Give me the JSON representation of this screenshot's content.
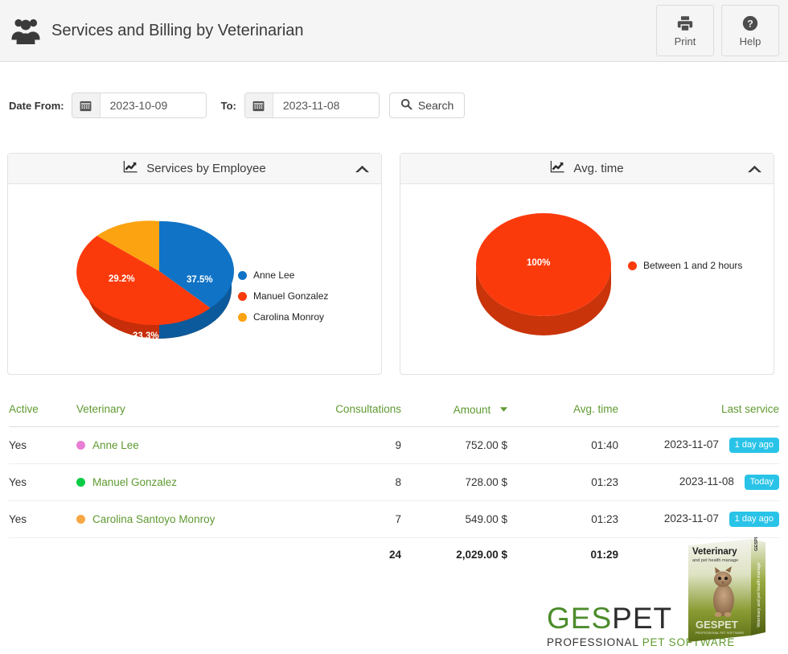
{
  "header": {
    "title": "Services and Billing by Veterinarian",
    "icon": "users-group-icon",
    "buttons": [
      {
        "label": "Print",
        "icon": "printer-icon"
      },
      {
        "label": "Help",
        "icon": "question-circle-icon"
      }
    ]
  },
  "filter": {
    "date_from_label": "Date From:",
    "date_from_value": "2023-10-09",
    "to_label": "To:",
    "date_to_value": "2023-11-08",
    "search_label": "Search",
    "calendar_icon": "calendar-icon",
    "search_icon": "search-icon"
  },
  "panels": [
    {
      "title": "Services by Employee",
      "icon": "chart-line-icon",
      "collapse_icon": "chevron-up-icon"
    },
    {
      "title": "Avg. time",
      "icon": "chart-line-icon",
      "collapse_icon": "chevron-up-icon"
    }
  ],
  "chart_data": [
    {
      "type": "pie",
      "title": "Services by Employee",
      "categories": [
        "Anne Lee",
        "Manuel  Gonzalez",
        "Carolina Monroy"
      ],
      "values": [
        37.5,
        33.3,
        29.2
      ],
      "labels": [
        "37.5%",
        "33.3%",
        "29.2%"
      ],
      "colors": [
        "#1073c6",
        "#fb3a0c",
        "#fca311"
      ],
      "legend_position": "right",
      "legend": [
        "Anne Lee",
        "Manuel  Gonzalez",
        "Carolina Monroy"
      ],
      "unit": "%"
    },
    {
      "type": "pie",
      "title": "Avg. time",
      "categories": [
        "Between 1 and 2 hours"
      ],
      "values": [
        100
      ],
      "labels": [
        "100%"
      ],
      "colors": [
        "#fb3a0c"
      ],
      "legend_position": "right",
      "legend": [
        "Between 1 and 2 hours"
      ],
      "unit": "%"
    }
  ],
  "table": {
    "columns": [
      "Active",
      "Veterinary",
      "Consultations",
      "Amount",
      "Avg. time",
      "Last service"
    ],
    "sorted_column": "Amount",
    "sort_direction": "desc",
    "rows": [
      {
        "active": "Yes",
        "veterinary": "Anne Lee",
        "dot_color": "#e87fd4",
        "consultations": "9",
        "amount": "752.00 $",
        "avg_time": "01:40",
        "last_service": "2023-11-07",
        "badge": "1 day ago"
      },
      {
        "active": "Yes",
        "veterinary": "Manuel Gonzalez",
        "dot_color": "#08cc46",
        "consultations": "8",
        "amount": "728.00 $",
        "avg_time": "01:23",
        "last_service": "2023-11-08",
        "badge": "Today"
      },
      {
        "active": "Yes",
        "veterinary": "Carolina Santoyo Monroy",
        "dot_color": "#f7a743",
        "consultations": "7",
        "amount": "549.00 $",
        "avg_time": "01:23",
        "last_service": "2023-11-07",
        "badge": "1 day ago"
      }
    ],
    "totals": {
      "consultations": "24",
      "amount": "2,029.00 $",
      "avg_time": "01:29"
    }
  },
  "footer": {
    "logo_ges": "GES",
    "logo_pet": "PET",
    "tagline_a": "PROFESSIONAL ",
    "tagline_b": "PET SOFTWARE",
    "box_title": "Veterinary",
    "box_subtitle": "and pet health manage",
    "box_brand": "GESPET",
    "box_spine": "Veterinary and pet health manage"
  }
}
